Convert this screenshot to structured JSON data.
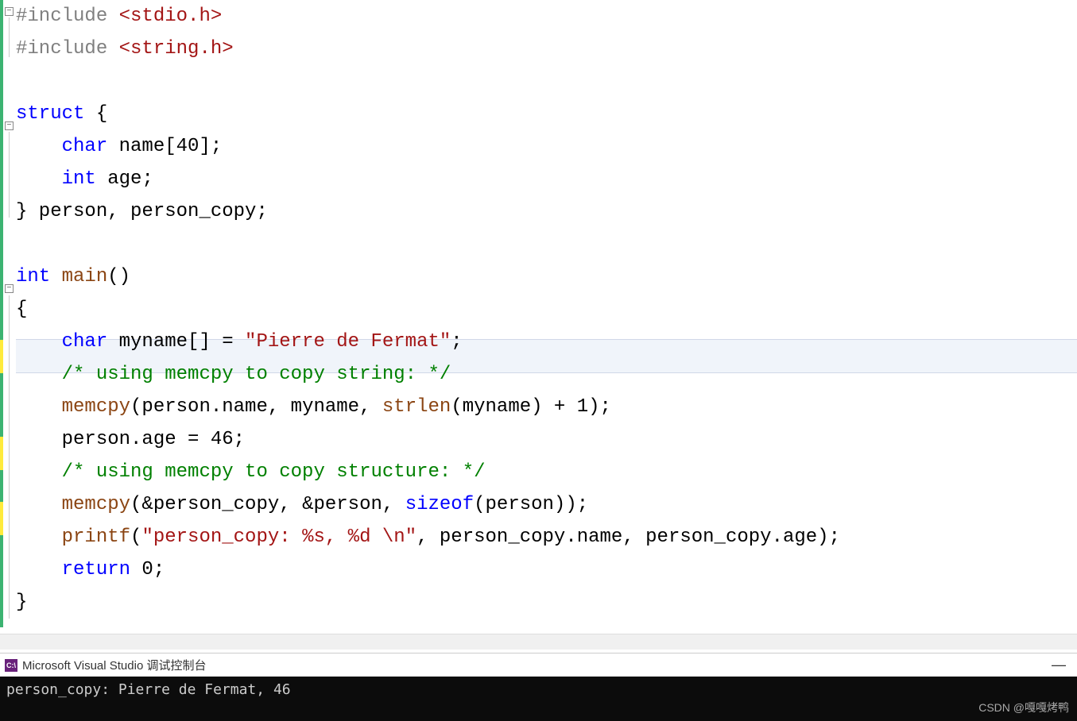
{
  "code": {
    "lines": [
      {
        "tokens": [
          {
            "t": "pre",
            "v": "#include"
          },
          {
            "t": "plain",
            "v": " "
          },
          {
            "t": "hdr",
            "v": "<stdio.h>"
          }
        ]
      },
      {
        "tokens": [
          {
            "t": "pre",
            "v": "#include"
          },
          {
            "t": "plain",
            "v": " "
          },
          {
            "t": "hdr",
            "v": "<string.h>"
          }
        ]
      },
      {
        "tokens": []
      },
      {
        "tokens": [
          {
            "t": "kw",
            "v": "struct"
          },
          {
            "t": "plain",
            "v": " {"
          }
        ]
      },
      {
        "tokens": [
          {
            "t": "plain",
            "v": "    "
          },
          {
            "t": "kw",
            "v": "char"
          },
          {
            "t": "plain",
            "v": " name[40];"
          }
        ]
      },
      {
        "tokens": [
          {
            "t": "plain",
            "v": "    "
          },
          {
            "t": "kw",
            "v": "int"
          },
          {
            "t": "plain",
            "v": " age;"
          }
        ]
      },
      {
        "tokens": [
          {
            "t": "plain",
            "v": "} person, person_copy;"
          }
        ]
      },
      {
        "tokens": []
      },
      {
        "tokens": [
          {
            "t": "kw",
            "v": "int"
          },
          {
            "t": "plain",
            "v": " "
          },
          {
            "t": "func",
            "v": "main"
          },
          {
            "t": "plain",
            "v": "()"
          }
        ]
      },
      {
        "tokens": [
          {
            "t": "plain",
            "v": "{"
          }
        ]
      },
      {
        "tokens": [
          {
            "t": "plain",
            "v": "    "
          },
          {
            "t": "kw",
            "v": "char"
          },
          {
            "t": "plain",
            "v": " myname[] = "
          },
          {
            "t": "str",
            "v": "\"Pierre de Fermat\""
          },
          {
            "t": "plain",
            "v": ";"
          }
        ],
        "current": true
      },
      {
        "tokens": [
          {
            "t": "plain",
            "v": "    "
          },
          {
            "t": "cmt",
            "v": "/* using memcpy to copy string: */"
          }
        ]
      },
      {
        "tokens": [
          {
            "t": "plain",
            "v": "    "
          },
          {
            "t": "func",
            "v": "memcpy"
          },
          {
            "t": "plain",
            "v": "(person.name, myname, "
          },
          {
            "t": "func",
            "v": "strlen"
          },
          {
            "t": "plain",
            "v": "(myname) + 1);"
          }
        ]
      },
      {
        "tokens": [
          {
            "t": "plain",
            "v": "    person.age = 46;"
          }
        ]
      },
      {
        "tokens": [
          {
            "t": "plain",
            "v": "    "
          },
          {
            "t": "cmt",
            "v": "/* using memcpy to copy structure: */"
          }
        ]
      },
      {
        "tokens": [
          {
            "t": "plain",
            "v": "    "
          },
          {
            "t": "func",
            "v": "memcpy"
          },
          {
            "t": "plain",
            "v": "(&person_copy, &person, "
          },
          {
            "t": "kw",
            "v": "sizeof"
          },
          {
            "t": "plain",
            "v": "(person));"
          }
        ]
      },
      {
        "tokens": [
          {
            "t": "plain",
            "v": "    "
          },
          {
            "t": "func",
            "v": "printf"
          },
          {
            "t": "plain",
            "v": "("
          },
          {
            "t": "str",
            "v": "\"person_copy: %s, %d \\n\""
          },
          {
            "t": "plain",
            "v": ", person_copy.name, person_copy.age);"
          }
        ]
      },
      {
        "tokens": [
          {
            "t": "plain",
            "v": "    "
          },
          {
            "t": "kw",
            "v": "return"
          },
          {
            "t": "plain",
            "v": " 0;"
          }
        ]
      },
      {
        "tokens": [
          {
            "t": "plain",
            "v": "}"
          }
        ]
      }
    ]
  },
  "console": {
    "icon_label": "C:\\",
    "title": "Microsoft Visual Studio 调试控制台",
    "output": "person_copy: Pierre de Fermat, 46"
  },
  "watermark": "CSDN @嘎嘎烤鸭"
}
